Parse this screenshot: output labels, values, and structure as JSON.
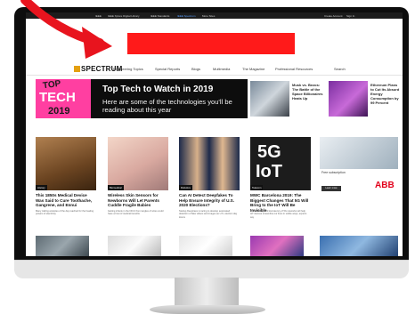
{
  "topbar": {
    "left_items": [
      "IEEE",
      "IEEE Xplore Digital Library",
      "IEEE Standards",
      "IEEE Spectrum",
      "More Sites"
    ],
    "right_items": [
      "Create Account",
      "Sign In"
    ]
  },
  "header": {
    "logo": "SPECTRUM",
    "nav": [
      "Engineering Topics",
      "Special Reports",
      "Blogs",
      "Multimedia",
      "The Magazine",
      "Professional Resources",
      "Search"
    ]
  },
  "hero": {
    "thumb_words": [
      "TOP",
      "TECH",
      "2019"
    ],
    "title": "Top Tech to Watch in 2019",
    "subtitle": "Here are some of the technologies you'll be reading about this year"
  },
  "side_stories": [
    {
      "title": "Musk vs. Bezos: The Battle of the Space Billionaires Heats Up"
    },
    {
      "title": "Ethereum Plans to Cut Its Absurd Energy Consumption by 99 Percent"
    }
  ],
  "cards": [
    {
      "tag": "History",
      "title": "This 1850s Medical Device Was Said to Cure Toothache, Gangrene, and Ennui",
      "desc": "Many trailing anxieties of the day reached for the healing powers of electricity"
    },
    {
      "tag": "Biomedical",
      "title": "Wireless Skin Sensors for Newborns Will Let Parents Cuddle Fragile Babies",
      "desc": "Getting infants in the NICU from tangles of wires could have a host of medical benefits"
    },
    {
      "tag": "Robotics",
      "title": "Can AI Detect Deepfakes To Help Ensure Integrity of U.S. 2020 Elections?",
      "desc": "Startup Deeptrace is racing to develop automated detection of fake videos and images as U.S. election day looms"
    },
    {
      "tag": "Telecom",
      "title": "MWC Barcelona 2019: The Biggest Changes That 5G Will Bring to the IoT Will Be Invisible",
      "desc": "The reliability and low latency of 5G networks will help IoT devices streamline our lives in subtle ways, experts say"
    }
  ],
  "ad": {
    "text": "Free subscription",
    "brand": "ABB",
    "button": "Learn more"
  },
  "colors": {
    "arrow": "#e8141e",
    "redaction": "#ff1a1a",
    "logo_mark": "#e4a010",
    "hero_pink": "#ff3fa1"
  }
}
